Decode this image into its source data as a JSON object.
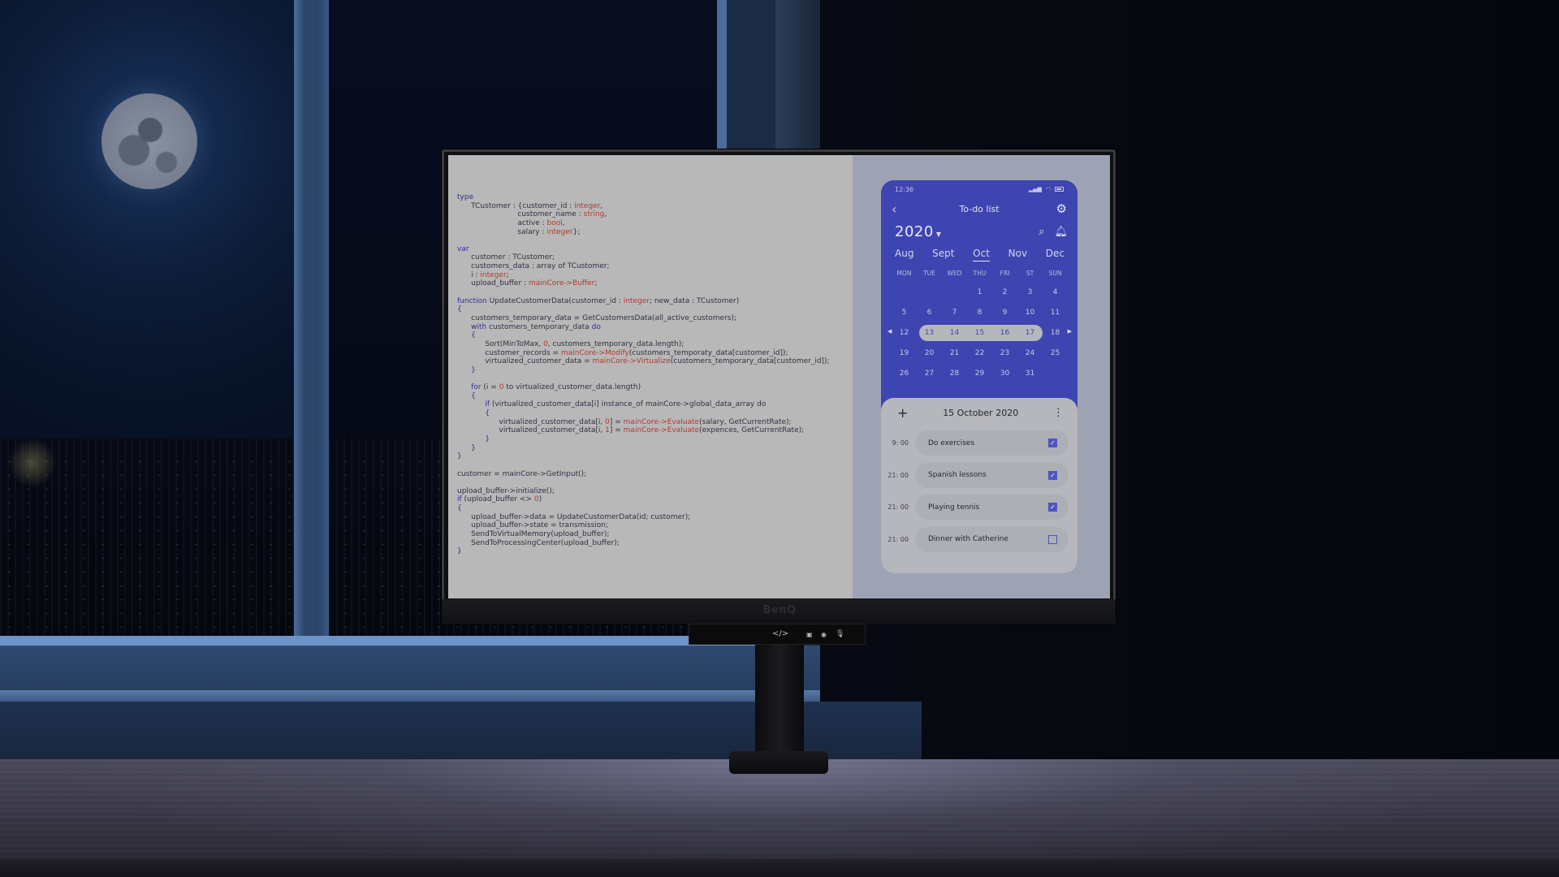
{
  "monitor": {
    "brand": "BenQ",
    "controls": [
      "link-icon",
      "menu-icon",
      "power-icon",
      "microphone-icon"
    ]
  },
  "code_editor": {
    "lines": [
      [
        {
          "t": "type",
          "c": "kw"
        }
      ],
      [
        {
          "t": "      TCustomer : {customer_id : ",
          "c": ""
        },
        {
          "t": "integer",
          "c": "ty"
        },
        {
          "t": ",",
          "c": ""
        }
      ],
      [
        {
          "t": "                          customer_name : ",
          "c": ""
        },
        {
          "t": "string",
          "c": "ty"
        },
        {
          "t": ",",
          "c": ""
        }
      ],
      [
        {
          "t": "                          active : ",
          "c": ""
        },
        {
          "t": "bool",
          "c": "ty"
        },
        {
          "t": ",",
          "c": ""
        }
      ],
      [
        {
          "t": "                          salary : ",
          "c": ""
        },
        {
          "t": "integer",
          "c": "ty"
        },
        {
          "t": "};",
          "c": ""
        }
      ],
      [],
      [
        {
          "t": "var",
          "c": "kw"
        }
      ],
      [
        {
          "t": "      customer : TCustomer;",
          "c": ""
        }
      ],
      [
        {
          "t": "      customers_data : array of TCustomer;",
          "c": ""
        }
      ],
      [
        {
          "t": "      i : ",
          "c": ""
        },
        {
          "t": "integer",
          "c": "ty"
        },
        {
          "t": ";",
          "c": ""
        }
      ],
      [
        {
          "t": "      upload_buffer : ",
          "c": ""
        },
        {
          "t": "mainCore->Buffer",
          "c": "ty"
        },
        {
          "t": ";",
          "c": ""
        }
      ],
      [],
      [
        {
          "t": "function",
          "c": "kw"
        },
        {
          "t": " UpdateCustomerData(customer_id : ",
          "c": ""
        },
        {
          "t": "integer",
          "c": "ty"
        },
        {
          "t": "; new_data : TCustomer)",
          "c": ""
        }
      ],
      [
        {
          "t": "{",
          "c": "kw"
        }
      ],
      [
        {
          "t": "      customers_temporary_data = GetCustomersData(all_active_customers);",
          "c": ""
        }
      ],
      [
        {
          "t": "      with",
          "c": "kw"
        },
        {
          "t": " customers_temporary_data ",
          "c": ""
        },
        {
          "t": "do",
          "c": "kw"
        }
      ],
      [
        {
          "t": "      {",
          "c": "kw"
        }
      ],
      [
        {
          "t": "            Sort(MinToMax, ",
          "c": ""
        },
        {
          "t": "0",
          "c": "ty"
        },
        {
          "t": ", customers_temporary_data.length);",
          "c": ""
        }
      ],
      [
        {
          "t": "            customer_records = ",
          "c": ""
        },
        {
          "t": "mainCore->Modify",
          "c": "ty"
        },
        {
          "t": "(customers_temporaty_data[customer_id]);",
          "c": ""
        }
      ],
      [
        {
          "t": "            virtualized_customer_data = ",
          "c": ""
        },
        {
          "t": "mainCore->Virtualize",
          "c": "ty"
        },
        {
          "t": "(customers_temporary_data[customer_id]);",
          "c": ""
        }
      ],
      [
        {
          "t": "      }",
          "c": "kw"
        }
      ],
      [],
      [
        {
          "t": "      for",
          "c": "kw"
        },
        {
          "t": " (i = ",
          "c": ""
        },
        {
          "t": "0",
          "c": "ty"
        },
        {
          "t": " to virtualized_customer_data.length)",
          "c": ""
        }
      ],
      [
        {
          "t": "      {",
          "c": "kw"
        }
      ],
      [
        {
          "t": "            if",
          "c": "kw"
        },
        {
          "t": " (virtualized_customer_data[i] instance_of mainCore->global_data_array do",
          "c": ""
        }
      ],
      [
        {
          "t": "            {",
          "c": "kw"
        }
      ],
      [
        {
          "t": "                  virtualized_customer_data[i, ",
          "c": ""
        },
        {
          "t": "0",
          "c": "ty"
        },
        {
          "t": "] = ",
          "c": ""
        },
        {
          "t": "mainCore->Evaluate",
          "c": "ty"
        },
        {
          "t": "(salary, GetCurrentRate);",
          "c": ""
        }
      ],
      [
        {
          "t": "                  virtualized_customer_data[i, ",
          "c": ""
        },
        {
          "t": "1",
          "c": "ty"
        },
        {
          "t": "] = ",
          "c": ""
        },
        {
          "t": "mainCore->Evaluate",
          "c": "ty"
        },
        {
          "t": "(expences, GetCurrentRate);",
          "c": ""
        }
      ],
      [
        {
          "t": "            }",
          "c": "kw"
        }
      ],
      [
        {
          "t": "      }",
          "c": "kw"
        }
      ],
      [
        {
          "t": "}",
          "c": "kw"
        }
      ],
      [],
      [
        {
          "t": "customer = mainCore->GetInput();",
          "c": ""
        }
      ],
      [],
      [
        {
          "t": "upload_buffer->initialize();",
          "c": ""
        }
      ],
      [
        {
          "t": "if",
          "c": "kw"
        },
        {
          "t": " (upload_buffer <> ",
          "c": ""
        },
        {
          "t": "0",
          "c": "ty"
        },
        {
          "t": ")",
          "c": ""
        }
      ],
      [
        {
          "t": "{",
          "c": "kw"
        }
      ],
      [
        {
          "t": "      upload_buffer->data = UpdateCustomerData(id; customer);",
          "c": ""
        }
      ],
      [
        {
          "t": "      upload_buffer->state = transmission;",
          "c": ""
        }
      ],
      [
        {
          "t": "      SendToVirtualMemory(upload_buffer);",
          "c": ""
        }
      ],
      [
        {
          "t": "      SendToProcessingCenter(upload_buffer);",
          "c": ""
        }
      ],
      [
        {
          "t": "}",
          "c": "kw"
        }
      ]
    ]
  },
  "todo_app": {
    "status_time": "12:36",
    "title": "To-do list",
    "year": "2020",
    "months": [
      {
        "label": "Aug",
        "active": false
      },
      {
        "label": "Sept",
        "active": false
      },
      {
        "label": "Oct",
        "active": true
      },
      {
        "label": "Nov",
        "active": false
      },
      {
        "label": "Dec",
        "active": false
      }
    ],
    "weekdays": [
      "MON",
      "TUE",
      "WED",
      "THU",
      "FRI",
      "ST",
      "SUN"
    ],
    "weeks": [
      [
        "",
        "",
        "",
        "1",
        "2",
        "3",
        "4"
      ],
      [
        "5",
        "6",
        "7",
        "8",
        "9",
        "10",
        "11"
      ],
      [
        "12",
        "13",
        "14",
        "15",
        "16",
        "17",
        "18"
      ],
      [
        "19",
        "20",
        "21",
        "22",
        "23",
        "24",
        "25"
      ],
      [
        "26",
        "27",
        "28",
        "29",
        "30",
        "31",
        ""
      ]
    ],
    "selected_week_index": 2,
    "selected_range": [
      "13",
      "17"
    ],
    "selected_date": "15 October 2020",
    "tasks": [
      {
        "time": "9: 00",
        "label": "Do exercises",
        "done": true
      },
      {
        "time": "21: 00",
        "label": "Spanish lessons",
        "done": true
      },
      {
        "time": "21: 00",
        "label": "Playing tennis",
        "done": true
      },
      {
        "time": "21: 00",
        "label": "Dinner with Catherine",
        "done": false
      }
    ],
    "accent_color": "#3e45b0"
  }
}
